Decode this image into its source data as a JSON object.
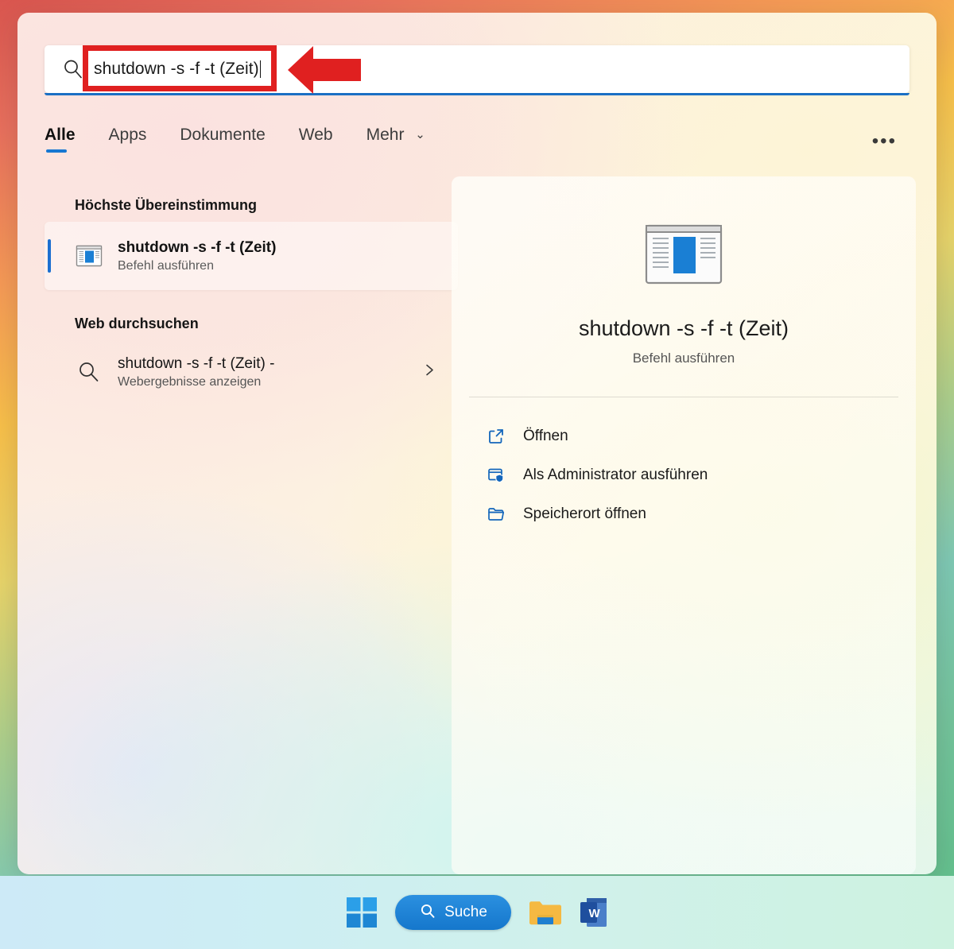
{
  "search": {
    "query": "shutdown -s -f -t (Zeit)",
    "icon": "search-icon"
  },
  "annotation": {
    "rect_color": "#e02020",
    "arrow_color": "#e02020",
    "arrow_direction": "left"
  },
  "tabs": {
    "items": [
      {
        "label": "Alle",
        "active": true
      },
      {
        "label": "Apps",
        "active": false
      },
      {
        "label": "Dokumente",
        "active": false
      },
      {
        "label": "Web",
        "active": false
      },
      {
        "label": "Mehr",
        "active": false,
        "chevron": "⌄"
      }
    ],
    "overflow_label": "•••",
    "active_accent": "#1677d2"
  },
  "results": {
    "best_match_heading": "Höchste Übereinstimmung",
    "best_match": {
      "title": "shutdown -s -f -t (Zeit)",
      "subtitle": "Befehl ausführen",
      "icon": "run-command-window-icon",
      "selected": true
    },
    "web_heading": "Web durchsuchen",
    "web_item": {
      "title": "shutdown -s -f -t (Zeit) -",
      "subtitle": "Webergebnisse anzeigen",
      "icon": "search-icon",
      "chevron": "chevron-right-icon"
    }
  },
  "preview": {
    "icon": "run-command-window-icon",
    "title": "shutdown -s -f -t (Zeit)",
    "subtitle": "Befehl ausführen",
    "actions": [
      {
        "label": "Öffnen",
        "icon": "open-external-icon"
      },
      {
        "label": "Als Administrator ausführen",
        "icon": "shield-admin-icon"
      },
      {
        "label": "Speicherort öffnen",
        "icon": "folder-icon"
      }
    ]
  },
  "taskbar": {
    "start_label": "start-button",
    "search_label": "Suche",
    "explorer_label": "file-explorer",
    "word_label": "W",
    "accent": "#1577cc"
  }
}
